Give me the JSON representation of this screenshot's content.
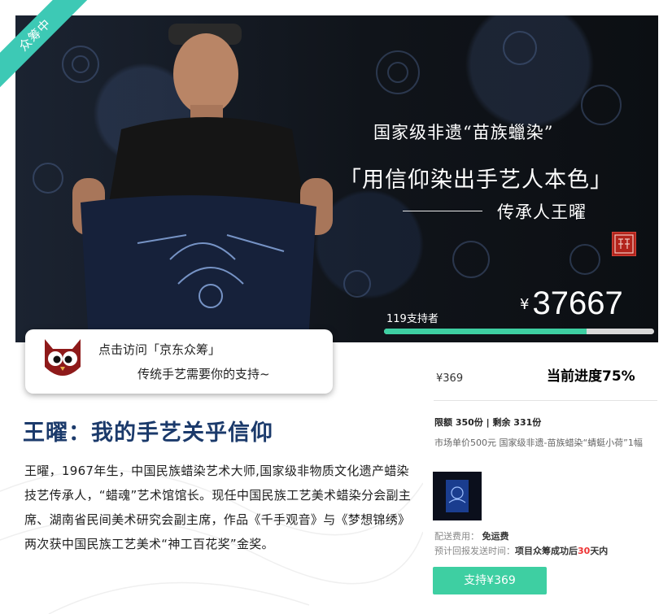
{
  "ribbon": {
    "label": "众筹中"
  },
  "hero": {
    "line1": "国家级非遗“苗族蠟染”",
    "line2": "「用信仰染出手艺人本色」",
    "line3": "传承人王曜",
    "supporters": "119支持者",
    "currency": "¥",
    "amount": "37667",
    "progress_fraction": 0.75
  },
  "bubble": {
    "line1": "点击访问「京东众筹」",
    "line2": "传统手艺需要你的支持~"
  },
  "article": {
    "headline": "王曜：我的手艺关乎信仰",
    "bio": "王曜，1967年生，中国民族蜡染艺术大师,国家级非物质文化遗产蜡染技艺传承人，“蜡魂”艺术馆馆长。现任中国民族工艺美术蜡染分会副主席、湖南省民间美术研究会副主席，作品《千手观音》与《梦想锦绣》两次获中国民族工艺美术“神工百花奖”金奖。"
  },
  "reward": {
    "price": "¥369",
    "progress_text": "当前进度75%",
    "limit": "限额 350份 | 剩余 331份",
    "description": "市场单价500元 国家级非遗-苗族蜡染“蜻蜓小荷”1幅",
    "shipping_label": "配送费用：",
    "shipping_value": "免运费",
    "delivery_label": "预计回报发送时间：",
    "delivery_prefix": "项目众筹成功后",
    "delivery_days": "30",
    "delivery_suffix": "天内",
    "button_label": "支持¥369"
  },
  "colors": {
    "accent": "#3ecfa2",
    "ribbon": "#3dc9b5",
    "headline": "#1b3a6b",
    "seal": "#b2231b"
  }
}
